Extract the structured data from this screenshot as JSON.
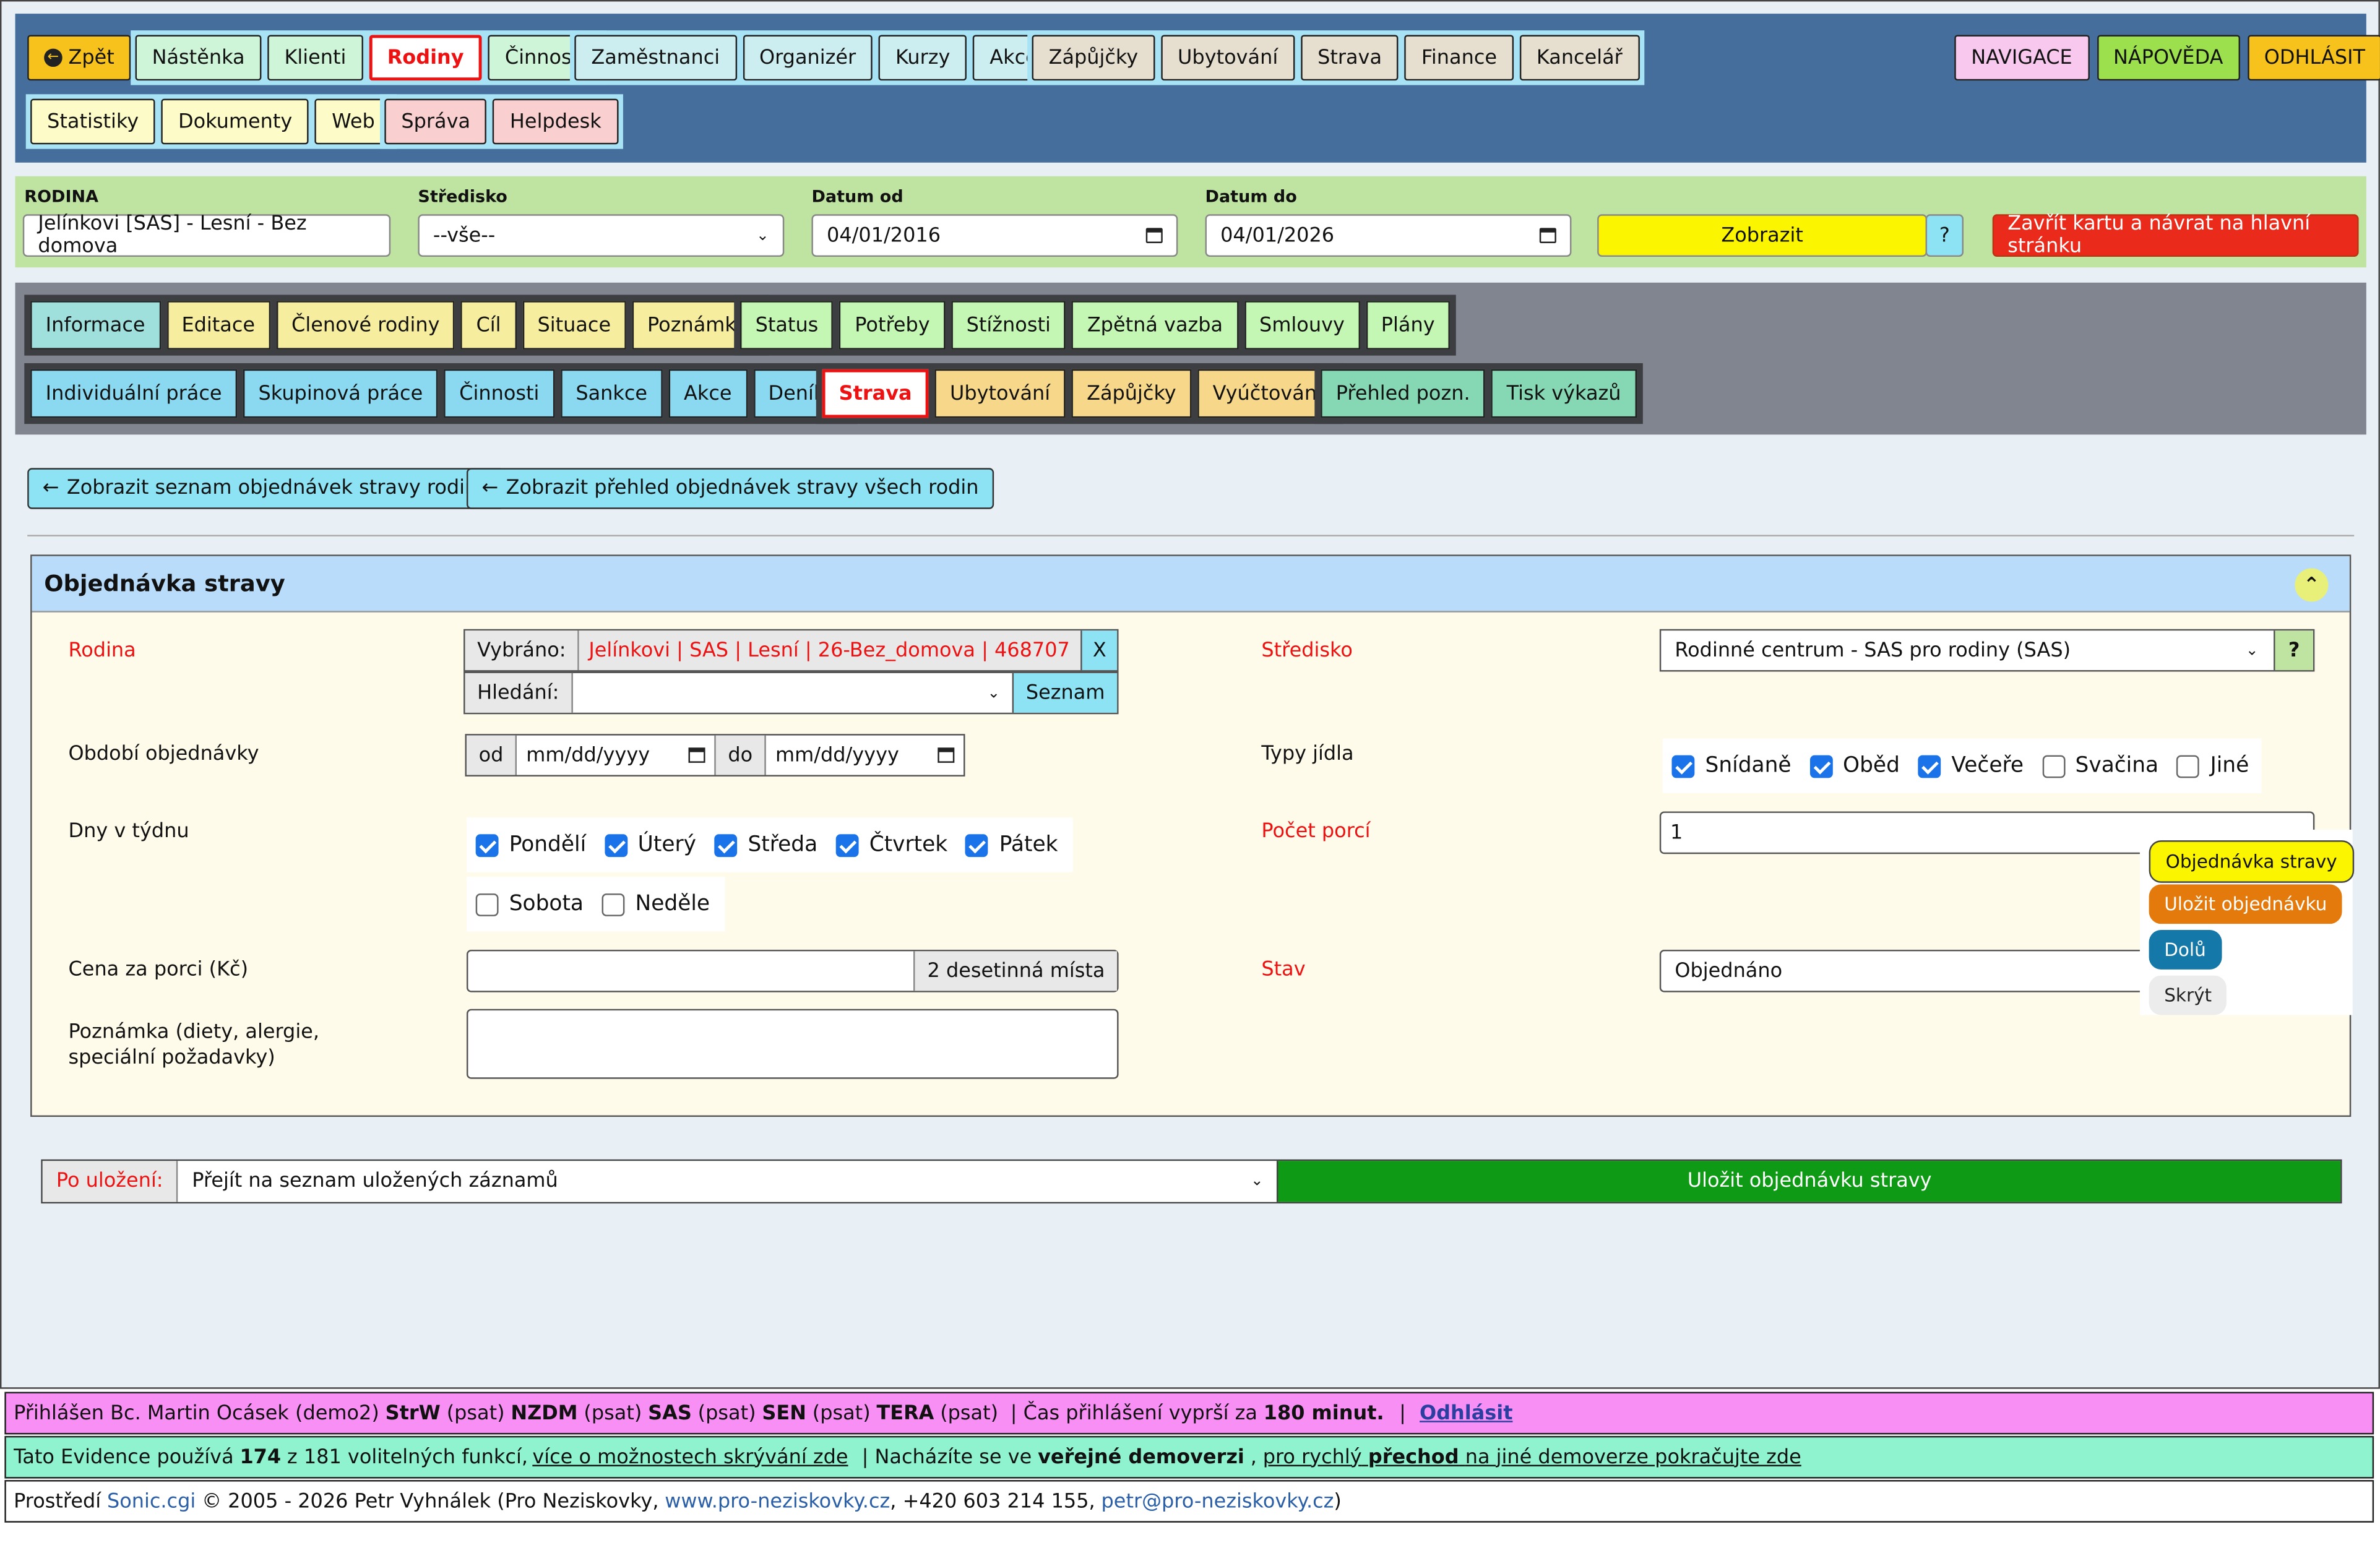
{
  "nav": {
    "back": "Zpět",
    "g1": [
      "Nástěnka",
      "Klienti",
      "Rodiny",
      "Činnosti"
    ],
    "g2": [
      "Zaměstnanci",
      "Organizér",
      "Kurzy",
      "Akce"
    ],
    "g3": [
      "Zápůjčky",
      "Ubytování",
      "Strava",
      "Finance",
      "Kancelář"
    ],
    "g4": [
      "Statistiky",
      "Dokumenty",
      "Web"
    ],
    "g5": [
      "Správa",
      "Helpdesk"
    ],
    "right": [
      "NAVIGACE",
      "NÁPOVĚDA",
      "ODHLÁSIT"
    ]
  },
  "filter": {
    "rodina_label": "RODINA",
    "rodina_value": "Jelínkovi [SAS] - Lesní - Bez domova",
    "stredisko_label": "Středisko",
    "stredisko_value": "--vše--",
    "od_label": "Datum od",
    "od_value": "04/01/2016",
    "do_label": "Datum do",
    "do_value": "04/01/2026",
    "zobrazit": "Zobrazit",
    "help": "?",
    "zavrit": "Zavřít kartu a návrat na hlavní stránku"
  },
  "tabs": {
    "r1a": [
      "Informace",
      "Editace",
      "Členové rodiny",
      "Cíl",
      "Situace",
      "Poznámky"
    ],
    "r1b": [
      "Status",
      "Potřeby",
      "Stížnosti",
      "Zpětná vazba",
      "Smlouvy",
      "Plány"
    ],
    "r2a": [
      "Individuální práce",
      "Skupinová práce",
      "Činnosti",
      "Sankce",
      "Akce",
      "Deníky"
    ],
    "r2b": [
      "Strava",
      "Ubytování",
      "Zápůjčky",
      "Vyúčtování"
    ],
    "r2c": [
      "Přehled pozn.",
      "Tisk výkazů"
    ]
  },
  "links": {
    "list": "Zobrazit seznam objednávek stravy rodiny",
    "all": "Zobrazit přehled objednávek stravy všech rodin"
  },
  "form": {
    "title": "Objednávka stravy",
    "rodina_label": "Rodina",
    "vybrano_label": "Vybráno:",
    "vybrano_value": "Jelínkovi | SAS | Lesní | 26-Bez_domova | 468707",
    "clear": "X",
    "hledani_label": "Hledání:",
    "seznam": "Seznam",
    "stredisko_label": "Středisko",
    "stredisko_value": "Rodinné centrum - SAS pro rodiny (SAS)",
    "stredisko_help": "?",
    "obdobi_label": "Období objednávky",
    "od": "od",
    "do": "do",
    "date_placeholder": "mm/dd/yyyy",
    "typy_label": "Typy jídla",
    "typy": [
      {
        "label": "Snídaně",
        "checked": true
      },
      {
        "label": "Oběd",
        "checked": true
      },
      {
        "label": "Večeře",
        "checked": true
      },
      {
        "label": "Svačina",
        "checked": false
      },
      {
        "label": "Jiné",
        "checked": false
      }
    ],
    "dny_label": "Dny v týdnu",
    "dny1": [
      {
        "label": "Pondělí",
        "checked": true
      },
      {
        "label": "Úterý",
        "checked": true
      },
      {
        "label": "Středa",
        "checked": true
      },
      {
        "label": "Čtvrtek",
        "checked": true
      },
      {
        "label": "Pátek",
        "checked": true
      }
    ],
    "dny2": [
      {
        "label": "Sobota",
        "checked": false
      },
      {
        "label": "Neděle",
        "checked": false
      }
    ],
    "pocet_label": "Počet porcí",
    "pocet_value": "1",
    "cena_label": "Cena za porci (Kč)",
    "cena_hint": "2 desetinná místa",
    "stav_label": "Stav",
    "stav_value": "Objednáno",
    "poznamka_label": "Poznámka (diety, alergie, speciální požadavky)"
  },
  "floating": {
    "objednavka": "Objednávka stravy",
    "ulozit": "Uložit objednávku",
    "dolu": "Dolů",
    "skryt": "Skrýt"
  },
  "bottom": {
    "po_ulozeni": "Po uložení:",
    "select": "Přejít na seznam uložených záznamů",
    "save": "Uložit objednávku stravy"
  },
  "footer": {
    "l1_pre": "Přihlášen Bc. Martin Ocásek (demo2)",
    "l1_a": "StrW",
    "l1_ap": "(psat)",
    "l1_b": "NZDM",
    "l1_bp": "(psat)",
    "l1_c": "SAS",
    "l1_cp": "(psat)",
    "l1_d": "SEN",
    "l1_dp": "(psat)",
    "l1_e": "TERA",
    "l1_ep": "(psat)",
    "l1_time": "|  Čas přihlášení vyprší za",
    "l1_min": "180 minut.",
    "l1_sep": "|",
    "l1_logout": "Odhlásit",
    "l2_pre": "Tato Evidence používá",
    "l2_count": "174",
    "l2_mid": "z 181 volitelných funkcí,",
    "l2_link": "více o možnostech skrývání zde",
    "l2_sep": "|  Nacházíte se ve",
    "l2_demo": "veřejné demoverzi",
    "l2_comma": ",",
    "l2_link2a": "pro rychlý",
    "l2_link2b": "přechod",
    "l2_link2c": "na jiné demoverze pokračujte zde",
    "l3_pre": "Prostředí",
    "l3_sonic": "Sonic.cgi",
    "l3_mid": "© 2005 - 2026 Petr Vyhnálek (Pro Neziskovky,",
    "l3_web": "www.pro-neziskovky.cz",
    "l3_phone": ", +420 603 214 155,",
    "l3_mail": "petr@pro-neziskovky.cz",
    "l3_end": ")"
  }
}
